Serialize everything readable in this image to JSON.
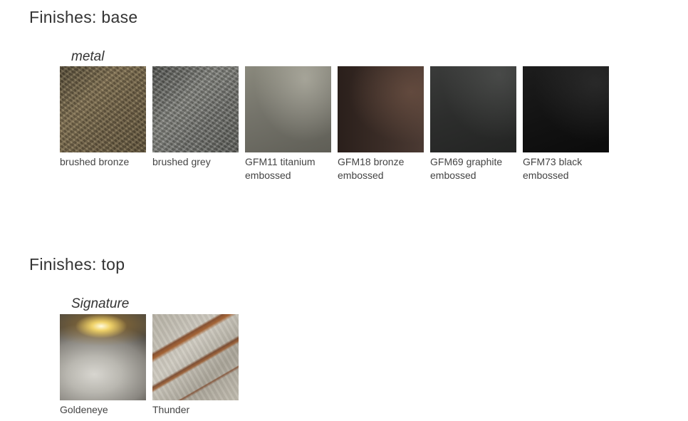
{
  "base": {
    "title": "Finishes: base",
    "group_label": "metal",
    "swatches": [
      {
        "label": "brushed bronze",
        "texture": "brushed-bronze",
        "color": "#6b5c41"
      },
      {
        "label": "brushed grey",
        "texture": "brushed-grey",
        "color": "#6a6b66"
      },
      {
        "label": "GFM11 titanium\nembossed",
        "texture": "gfm11",
        "color": "#74736a"
      },
      {
        "label": "GFM18 bronze\nembossed",
        "texture": "gfm18",
        "color": "#3b2d27"
      },
      {
        "label": "GFM69 graphite\nembossed",
        "texture": "gfm69",
        "color": "#2c2d2c"
      },
      {
        "label": "GFM73 black\nembossed",
        "texture": "gfm73",
        "color": "#121212"
      }
    ]
  },
  "top": {
    "title": "Finishes: top",
    "group_label": "Signature",
    "swatches": [
      {
        "label": "Goldeneye",
        "texture": "goldeneye",
        "color": "#b9b7b0"
      },
      {
        "label": "Thunder",
        "texture": "thunder",
        "color": "#b7b2a6"
      }
    ]
  }
}
